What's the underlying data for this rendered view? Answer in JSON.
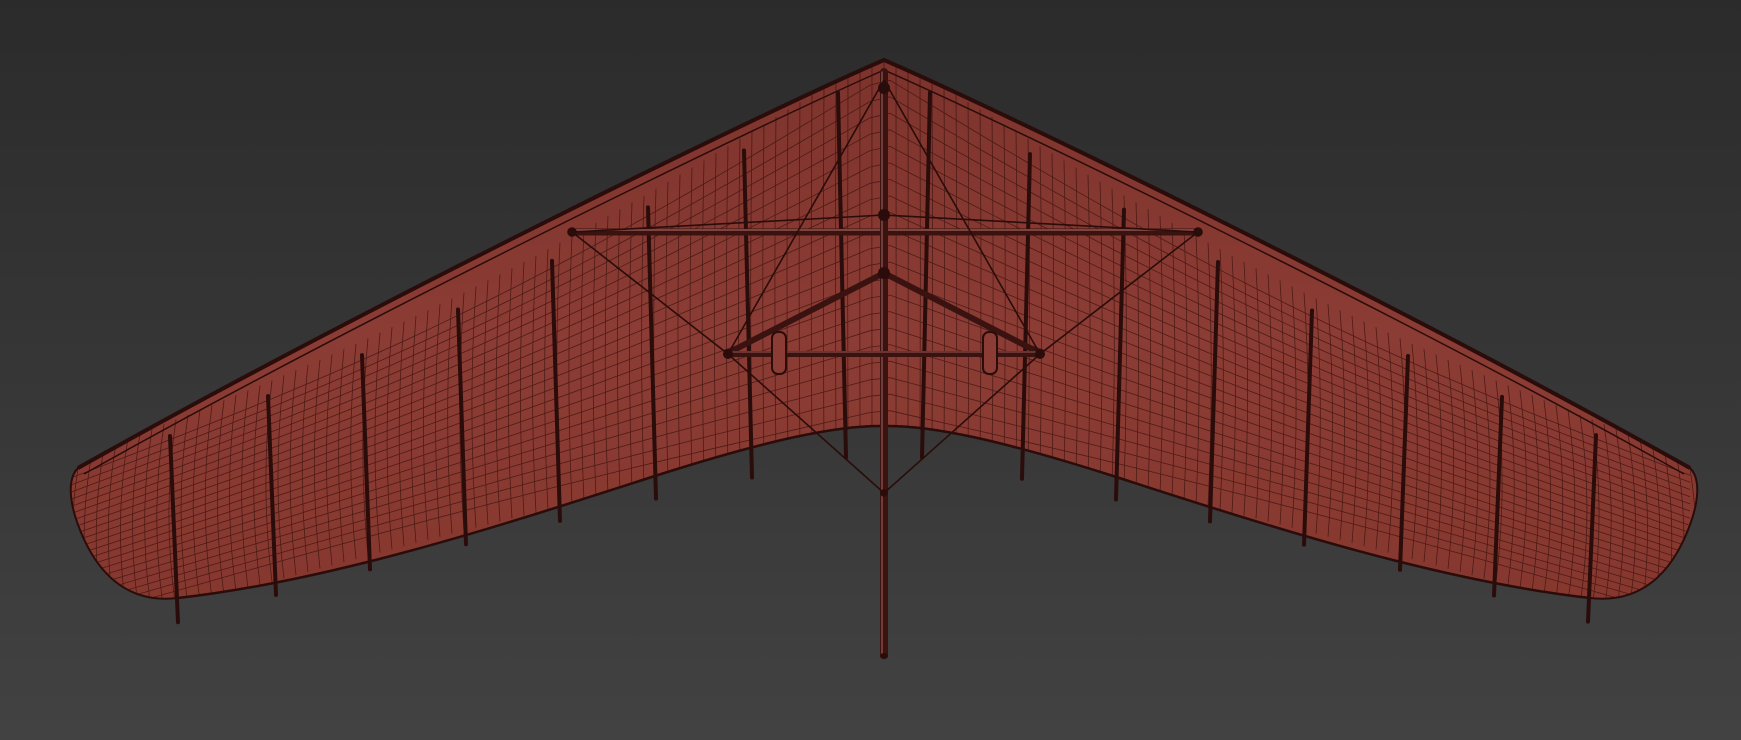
{
  "scene": {
    "subject": "hang-glider-wireframe",
    "view": "bottom",
    "colors": {
      "background_top": "#2b2b2b",
      "background_bottom": "#424242",
      "sail_fill": "#8a3b33",
      "sail_fill_dark": "#6f2b25",
      "wire": "#2a0c0a",
      "tube": "#3a1210",
      "tube_highlight": "#b8706a"
    }
  }
}
